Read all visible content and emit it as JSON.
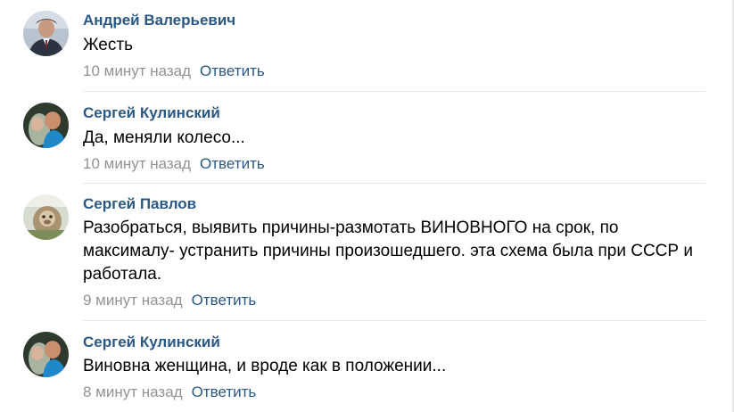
{
  "reply_label": "Ответить",
  "comments": [
    {
      "author": "Андрей Валерьевич",
      "text": "Жесть",
      "time": "10 минут назад",
      "avatar_icon": "person-in-suit-photo"
    },
    {
      "author": "Сергей Кулинский",
      "text": "Да, меняли колесо...",
      "time": "10 минут назад",
      "avatar_icon": "couple-photo"
    },
    {
      "author": "Сергей Павлов",
      "text": "Разобраться, выявить причины-размотать ВИНОВНОГО на срок, по максималу- устранить причины произошедшего. эта схема была при СССР и работала.",
      "time": "9 минут назад",
      "avatar_icon": "monkey-photo"
    },
    {
      "author": "Сергей Кулинский",
      "text": "Виновна женщина, и вроде как в положении...",
      "time": "8 минут назад",
      "avatar_icon": "couple-photo"
    }
  ],
  "colors": {
    "author_link": "#2a5885",
    "meta_gray": "#939393",
    "divider": "#e7e8ec"
  }
}
